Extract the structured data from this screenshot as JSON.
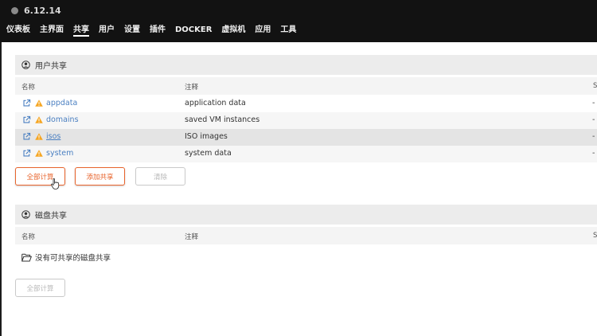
{
  "version": "6.12.14",
  "nav": [
    "仪表板",
    "主界面",
    "共享",
    "用户",
    "设置",
    "插件",
    "DOCKER",
    "虚拟机",
    "应用",
    "工具"
  ],
  "user_shares": {
    "title": "用户共享",
    "col_name": "名称",
    "col_note": "注释",
    "col_extra": "S",
    "rows": [
      {
        "name": "appdata",
        "note": "application data",
        "extra": "-"
      },
      {
        "name": "domains",
        "note": "saved VM instances",
        "extra": "-"
      },
      {
        "name": "isos",
        "note": "ISO images",
        "extra": "-"
      },
      {
        "name": "system",
        "note": "system data",
        "extra": "-"
      }
    ],
    "btn_compute_all": "全部计算",
    "btn_add_share": "添加共享",
    "btn_clear": "清除"
  },
  "disk_shares": {
    "title": "磁盘共享",
    "col_name": "名称",
    "col_note": "注释",
    "col_extra": "S",
    "empty_text": "没有可共享的磁盘共享",
    "btn_compute_all": "全部计算"
  },
  "colors": {
    "accent": "#e8642c",
    "link": "#4a7fc1",
    "warning": "#f5a623",
    "topbar": "#121212"
  }
}
